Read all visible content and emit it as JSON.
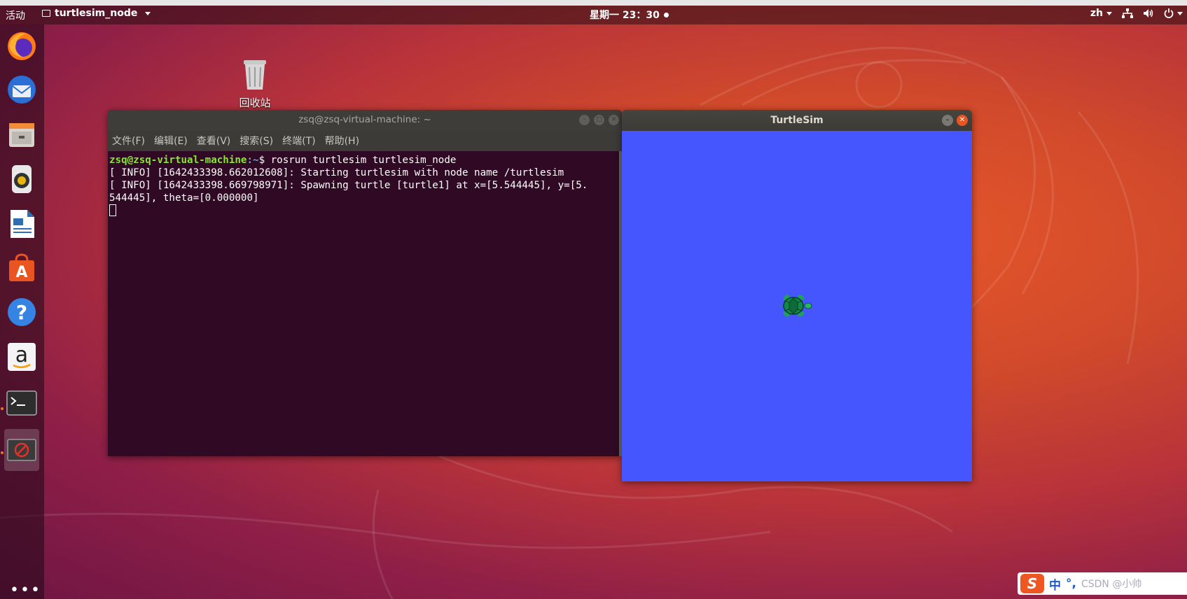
{
  "topbar": {
    "activities": "活动",
    "app_name": "turtlesim_node",
    "clock": "星期一 23：30",
    "lang": "zh"
  },
  "dock": {
    "items": [
      {
        "name": "firefox-icon"
      },
      {
        "name": "thunderbird-icon"
      },
      {
        "name": "files-icon"
      },
      {
        "name": "rhythmbox-icon"
      },
      {
        "name": "writer-icon"
      },
      {
        "name": "software-icon"
      },
      {
        "name": "help-icon"
      },
      {
        "name": "amazon-icon"
      },
      {
        "name": "terminal-icon"
      },
      {
        "name": "turtlesim-app-icon"
      }
    ]
  },
  "desktop": {
    "trash_label": "回收站"
  },
  "terminal": {
    "title": "zsq@zsq-virtual-machine: ~",
    "menu": [
      "文件(F)",
      "编辑(E)",
      "查看(V)",
      "搜索(S)",
      "终端(T)",
      "帮助(H)"
    ],
    "prompt_user": "zsq@zsq-virtual-machine",
    "prompt_path": ":~",
    "prompt_suffix": "$ rosrun turtlesim turtlesim_node",
    "line1": "[ INFO] [1642433398.662012608]: Starting turtlesim with node name /turtlesim",
    "line2": "[ INFO] [1642433398.669798971]: Spawning turtle [turtle1] at x=[5.544445], y=[5.",
    "line3": "544445], theta=[0.000000]"
  },
  "turtlesim": {
    "title": "TurtleSim",
    "background": "#4556ff"
  },
  "ime": {
    "mode": "中",
    "watermark": "CSDN @小帅"
  }
}
